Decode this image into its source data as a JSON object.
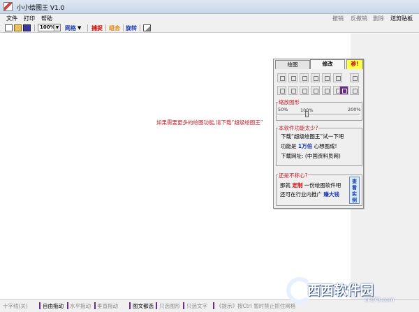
{
  "window": {
    "title": "小小绘图王 V1.0"
  },
  "menu": {
    "items": [
      "文件",
      "打印",
      "帮助"
    ],
    "right_items": [
      "撤销",
      "反撤销",
      "删除",
      "送剪贴板"
    ]
  },
  "toolbar": {
    "zoom_value": "100%",
    "grid_label": "网格",
    "snap_label": "捕捉",
    "group_label": "组合",
    "rotate_label": "旋转",
    "colors": {
      "snap": "#cc0000",
      "group": "#e08000",
      "rotate": "#1a3ab0",
      "grid": "#1a3ab0"
    }
  },
  "canvas": {
    "message": "如果需要更多的绘图功能,请下载“超级绘图王”"
  },
  "panel": {
    "tabs": [
      "绘图",
      "修改",
      "移!"
    ],
    "scale": {
      "title": "缩放图形",
      "min": "50%",
      "mid": "100%",
      "max": "200%"
    },
    "too_few": {
      "title": "本软件功能太少?",
      "line1": "下载“超级绘图王”试一下吧",
      "line2_a": "功能是",
      "line2_b": "1万倍",
      "line2_c": "心想图成!",
      "line3": "下载网址: (中国资料员网)"
    },
    "not_satisfied": {
      "title": "还是不称心?",
      "line1_a": "那就",
      "line1_b": "定制",
      "line1_c": "一份绘图软件吧",
      "line2_a": "还可在行业内推广",
      "line2_b": "赚大钱",
      "example_button": "查看实例"
    }
  },
  "statusbar": {
    "items": [
      "十字线(关)",
      "自由拖动",
      "水平拖动",
      "垂直拖动",
      "图文都选",
      "只选图形",
      "只选文字",
      "《提示》按Ctrl 暂时禁止抓住网格"
    ]
  },
  "watermark": {
    "text": "西西软件园",
    "url": "cr173.com"
  }
}
